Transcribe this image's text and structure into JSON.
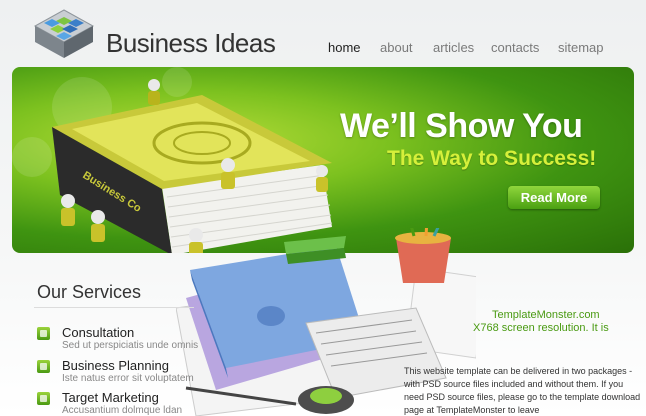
{
  "header": {
    "logo_text": "Business Ideas",
    "nav": [
      {
        "label": "home",
        "active": true
      },
      {
        "label": "about",
        "active": false
      },
      {
        "label": "articles",
        "active": false
      },
      {
        "label": "contacts",
        "active": false
      },
      {
        "label": "sitemap",
        "active": false
      }
    ]
  },
  "banner": {
    "headline": "We’ll Show You",
    "subheadline": "The Way to Success!",
    "button_label": "Read More",
    "book_spine_text": "Business Co"
  },
  "services": {
    "title": "Our Services",
    "items": [
      {
        "name": "Consultation",
        "desc": "Sed ut perspiciatis unde omnis"
      },
      {
        "name": "Business Planning",
        "desc": "Iste natus error sit voluptatem"
      },
      {
        "name": "Target Marketing",
        "desc": "Accusantium dolmque ldan"
      }
    ]
  },
  "info": {
    "tm_line1": "TemplateMonster.com",
    "tm_line2": "X768 screen resolution. It is",
    "paragraph": "This website template can be delivered in two packages - with PSD source files included and without them. If you need PSD source files, please go to the template download page at TemplateMonster to leave"
  },
  "colors": {
    "accent_green": "#4a9a12",
    "headline_yellow": "#d6f03a",
    "nav_active": "#222222"
  }
}
